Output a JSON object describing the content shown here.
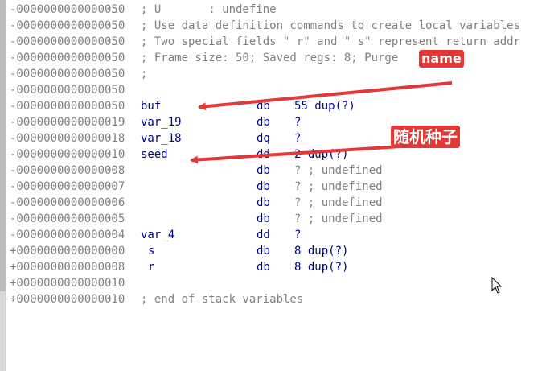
{
  "rows": [
    {
      "offset": "-0000000000000050",
      "kind": "comment",
      "text": "; U       : undefine"
    },
    {
      "offset": "-0000000000000050",
      "kind": "comment",
      "text": "; Use data definition commands to create local variables"
    },
    {
      "offset": "-0000000000000050",
      "kind": "comment",
      "text": "; Two special fields \" r\" and \" s\" represent return addr"
    },
    {
      "offset": "-0000000000000050",
      "kind": "comment",
      "text": "; Frame size: 50; Saved regs: 8; Purge"
    },
    {
      "offset": "-0000000000000050",
      "kind": "comment",
      "text": ";"
    },
    {
      "offset": "-0000000000000050",
      "kind": "blank"
    },
    {
      "offset": "-0000000000000050",
      "kind": "var",
      "name": "buf",
      "type": "db",
      "rest": "55 dup(?)"
    },
    {
      "offset": "-0000000000000019",
      "kind": "var",
      "name": "var_19",
      "type": "db",
      "rest": "?"
    },
    {
      "offset": "-0000000000000018",
      "kind": "var",
      "name": "var_18",
      "type": "dq",
      "rest": "?"
    },
    {
      "offset": "-0000000000000010",
      "kind": "var",
      "name": "seed",
      "type": "dd",
      "rest": "2 dup(?)"
    },
    {
      "offset": "-0000000000000008",
      "kind": "var",
      "name": "",
      "type": "db",
      "rest": "? ; undefined"
    },
    {
      "offset": "-0000000000000007",
      "kind": "var",
      "name": "",
      "type": "db",
      "rest": "? ; undefined"
    },
    {
      "offset": "-0000000000000006",
      "kind": "var",
      "name": "",
      "type": "db",
      "rest": "? ; undefined"
    },
    {
      "offset": "-0000000000000005",
      "kind": "var",
      "name": "",
      "type": "db",
      "rest": "? ; undefined"
    },
    {
      "offset": "-0000000000000004",
      "kind": "var",
      "name": "var_4",
      "type": "dd",
      "rest": "?"
    },
    {
      "offset": "+0000000000000000",
      "kind": "field",
      "name": "s",
      "type": "db",
      "rest": "8 dup(?)"
    },
    {
      "offset": "+0000000000000008",
      "kind": "field",
      "name": "r",
      "type": "db",
      "rest": "8 dup(?)"
    },
    {
      "offset": "+0000000000000010",
      "kind": "blank"
    },
    {
      "offset": "+0000000000000010",
      "kind": "comment",
      "text": "; end of stack variables"
    }
  ],
  "annotations": {
    "name_label": "name",
    "seed_label": "随机种子",
    "color": "#e23838"
  },
  "colors": {
    "offset": "#808080",
    "identifier": "#00008b",
    "comment": "#808080"
  },
  "icons": {
    "cursor": "mouse-pointer-icon"
  }
}
